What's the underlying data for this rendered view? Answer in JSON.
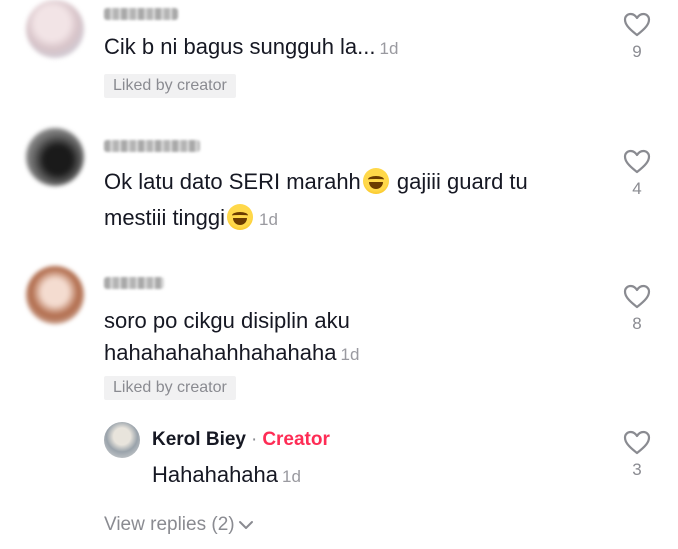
{
  "comments": [
    {
      "text": "Cik b ni bagus sungguh la...",
      "time": "1d",
      "liked_by_creator": "Liked by creator",
      "likes": "9"
    },
    {
      "text_line1": "Ok latu dato SERI marahh",
      "text_line1_after": " gajiii guard tu",
      "text_line2": "mestiii tinggi",
      "time": "1d",
      "likes": "4",
      "emoji": "face-with-tears-of-joy"
    },
    {
      "text_line1": "soro po cikgu disiplin aku",
      "text_line2": "hahahahahahhahahaha",
      "time": "1d",
      "liked_by_creator": "Liked by creator",
      "likes": "8",
      "reply": {
        "username": "Kerol Biey",
        "separator": "·",
        "badge": "Creator",
        "text": "Hahahahaha",
        "time": "1d",
        "likes": "3"
      }
    }
  ],
  "view_replies": "View replies (2)",
  "colors": {
    "creator_badge": "#fe2c55",
    "muted": "#8a8b91",
    "text": "#161823",
    "chip_bg": "#f1f1f2"
  }
}
